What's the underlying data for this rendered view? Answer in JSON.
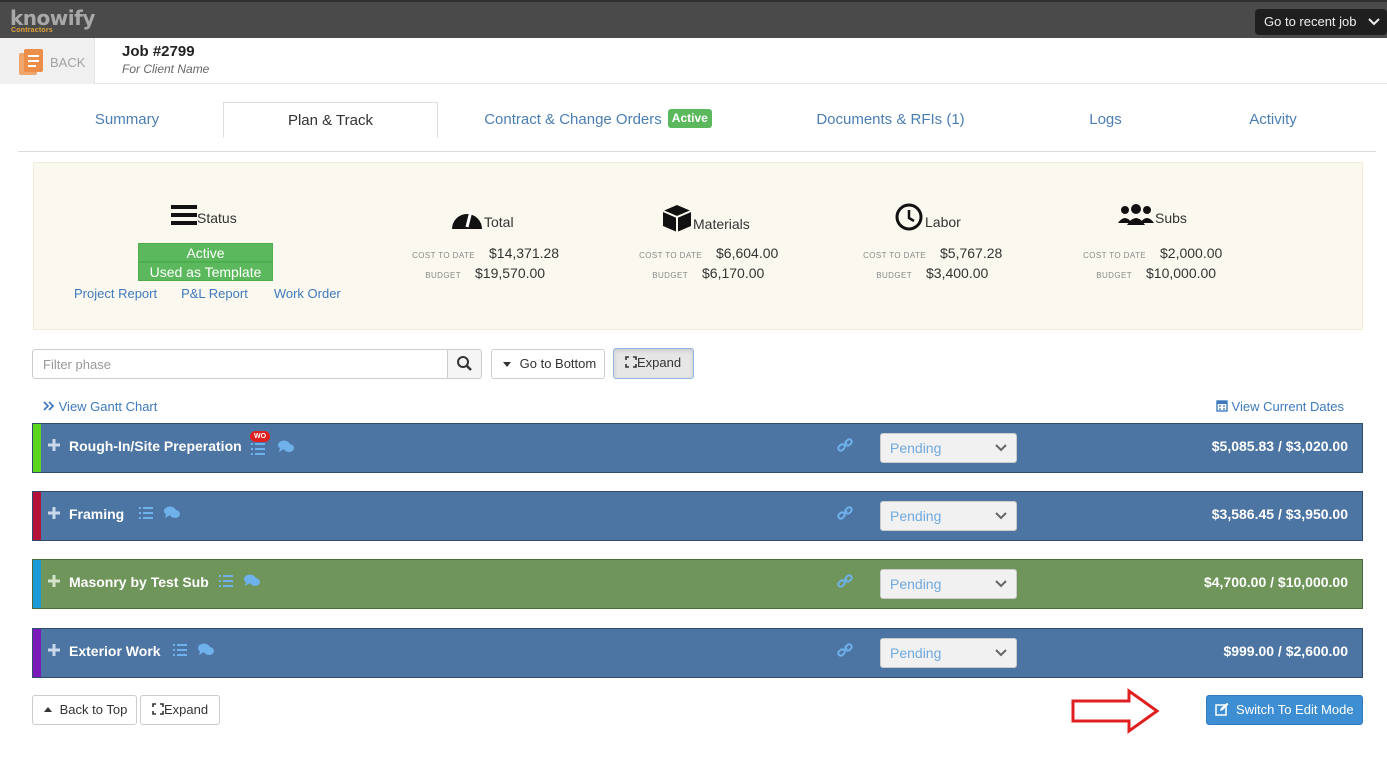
{
  "app": {
    "logo": "knowify",
    "logo_sub": "Contractors",
    "recent_job": "Go to recent job"
  },
  "job": {
    "back_label": "BACK",
    "title": "Job #2799",
    "client": "For Client Name"
  },
  "tabs": [
    {
      "label": "Summary"
    },
    {
      "label": "Plan & Track"
    },
    {
      "label": "Contract & Change Orders",
      "badge": "Active"
    },
    {
      "label": "Documents & RFIs (1)"
    },
    {
      "label": "Logs"
    },
    {
      "label": "Activity"
    }
  ],
  "summary": {
    "status_label": "Status",
    "status_badges": [
      "Active",
      "Used as Template"
    ],
    "links": [
      "Project Report",
      "P&L Report",
      "Work Order"
    ],
    "cost_to_date_label": "COST TO DATE",
    "budget_label": "BUDGET",
    "blocks": [
      {
        "label": "Total",
        "cost_to_date": "$14,371.28",
        "budget": "$19,570.00"
      },
      {
        "label": "Materials",
        "cost_to_date": "$6,604.00",
        "budget": "$6,170.00"
      },
      {
        "label": "Labor",
        "cost_to_date": "$5,767.28",
        "budget": "$3,400.00"
      },
      {
        "label": "Subs",
        "cost_to_date": "$2,000.00",
        "budget": "$10,000.00"
      }
    ]
  },
  "toolbar": {
    "filter_placeholder": "Filter phase",
    "go_to_bottom": "Go to Bottom",
    "expand": "Expand",
    "view_gantt": "View Gantt Chart",
    "view_dates": "View Current Dates"
  },
  "phases": [
    {
      "name": "Rough-In/Site Preperation",
      "wo_badge": "WO",
      "status": "Pending",
      "amount": "$5,085.83 / $3,020.00",
      "bar_color": "#5cd61c",
      "bg_color": "#4d75a3"
    },
    {
      "name": "Framing",
      "status": "Pending",
      "amount": "$3,586.45 / $3,950.00",
      "bar_color": "#b3103a",
      "bg_color": "#4d75a3"
    },
    {
      "name": "Masonry by Test Sub",
      "status": "Pending",
      "amount": "$4,700.00 / $10,000.00",
      "bar_color": "#1c9bd6",
      "bg_color": "#6f955a"
    },
    {
      "name": "Exterior Work",
      "status": "Pending",
      "amount": "$999.00 / $2,600.00",
      "bar_color": "#7a1ab8",
      "bg_color": "#4d75a3"
    }
  ],
  "footer": {
    "back_to_top": "Back to Top",
    "expand": "Expand",
    "edit_mode": "Switch To Edit Mode"
  },
  "colors": {
    "accent": "#3f7abd",
    "success": "#5cb85c",
    "phase_blue": "#4d75a3",
    "phase_green": "#6f955a",
    "arrow": "#e02020"
  }
}
